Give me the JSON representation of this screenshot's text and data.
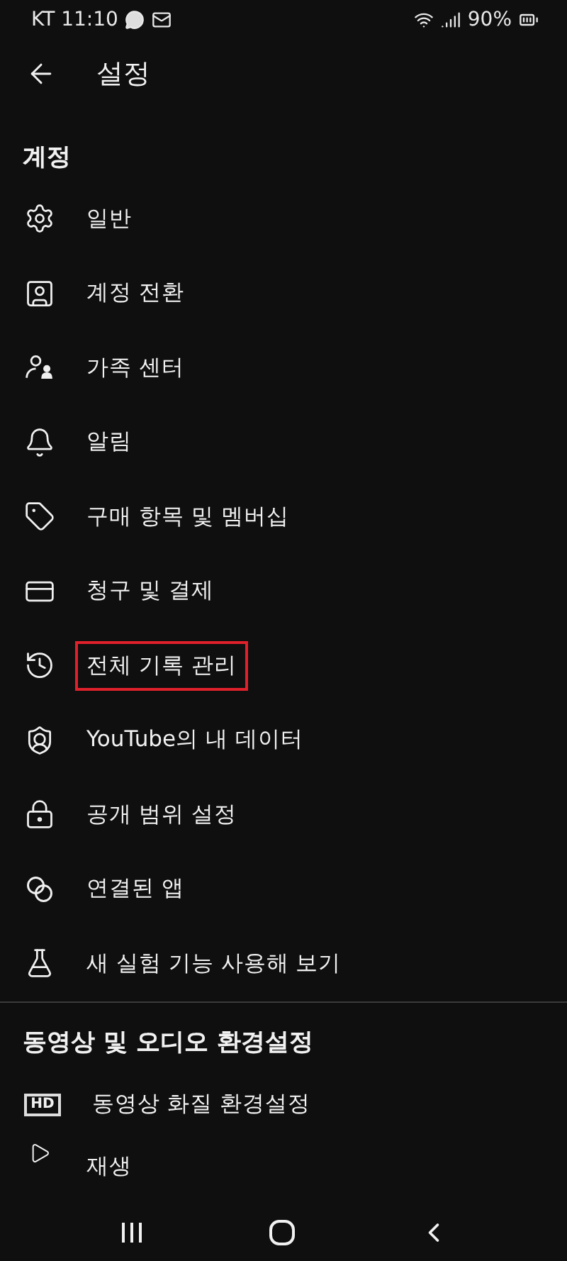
{
  "status_bar": {
    "carrier_time": "KT 11:10",
    "battery": "90%"
  },
  "header": {
    "title": "설정"
  },
  "sections": [
    {
      "title": "계정",
      "items": [
        {
          "label": "일반",
          "kind": "gear",
          "highlighted": false
        },
        {
          "label": "계정 전환",
          "kind": "account",
          "highlighted": false
        },
        {
          "label": "가족 센터",
          "kind": "family",
          "highlighted": false
        },
        {
          "label": "알림",
          "kind": "bell",
          "highlighted": false
        },
        {
          "label": "구매 항목 및 멤버십",
          "kind": "tag",
          "highlighted": false
        },
        {
          "label": "청구 및 결제",
          "kind": "card",
          "highlighted": false
        },
        {
          "label": "전체 기록 관리",
          "kind": "history",
          "highlighted": true
        },
        {
          "label": "YouTube의 내 데이터",
          "kind": "shield",
          "highlighted": false
        },
        {
          "label": "공개 범위 설정",
          "kind": "lock",
          "highlighted": false
        },
        {
          "label": "연결된 앱",
          "kind": "circles",
          "highlighted": false
        },
        {
          "label": "새 실험 기능 사용해 보기",
          "kind": "flask",
          "highlighted": false
        }
      ]
    },
    {
      "title": "동영상 및 오디오 환경설정",
      "items": [
        {
          "label": "동영상 화질 환경설정",
          "kind": "hd",
          "icon_text": "HD",
          "highlighted": false
        },
        {
          "label": "재생",
          "kind": "play",
          "highlighted": false
        }
      ]
    }
  ]
}
